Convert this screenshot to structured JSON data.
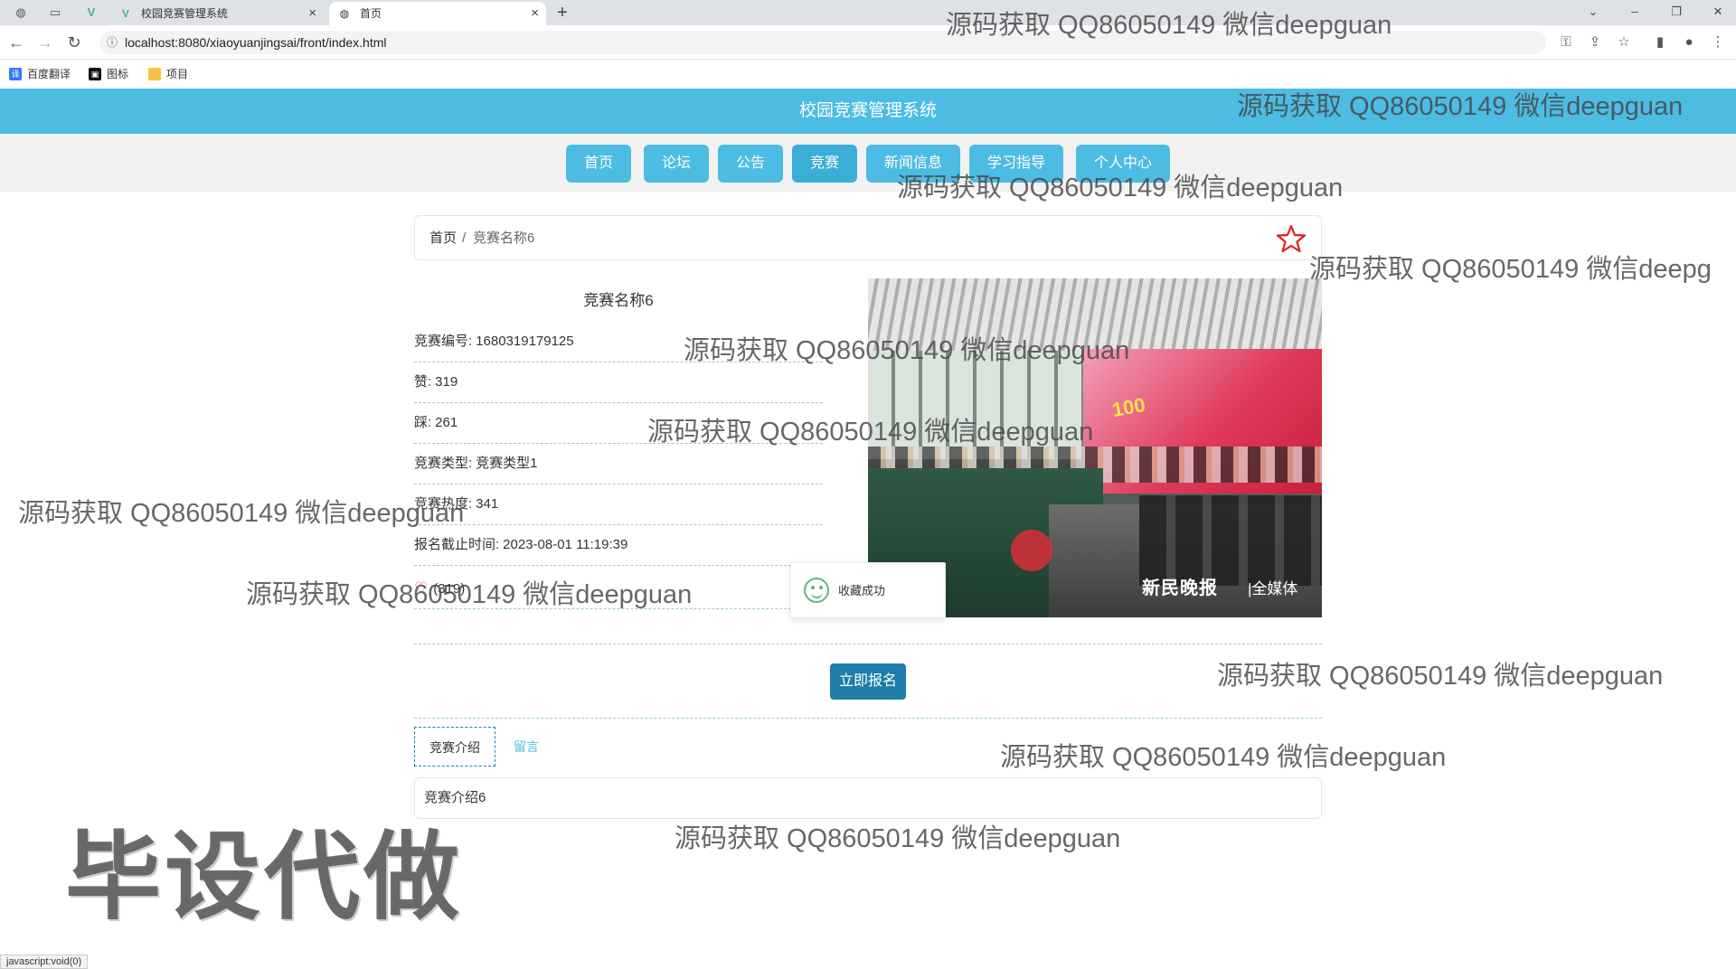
{
  "browser": {
    "tabs": [
      {
        "title": "校园竞赛管理系统",
        "favicon": "vue-logo-icon",
        "active": false
      },
      {
        "title": "首页",
        "favicon": "globe-icon",
        "active": true
      }
    ],
    "url": "localhost:8080/xiaoyuanjingsai/front/index.html",
    "bookmarks": [
      "百度翻译",
      "图标",
      "项目"
    ],
    "status_text": "javascript:void(0)"
  },
  "site": {
    "title": "校园竞赛管理系统",
    "nav": [
      "首页",
      "论坛",
      "公告",
      "竞赛",
      "新闻信息",
      "学习指导",
      "个人中心"
    ],
    "active_nav": "竞赛",
    "header_color": "#4cbce3"
  },
  "breadcrumb": {
    "home": "首页",
    "separator": "/",
    "current": "竞赛名称6"
  },
  "detail": {
    "title": "竞赛名称6",
    "fields": [
      {
        "label": "竞赛编号:",
        "value": "1680319179125"
      },
      {
        "label": "赞:",
        "value": "319"
      },
      {
        "label": "踩:",
        "value": "261"
      },
      {
        "label": "竞赛类型:",
        "value": "竞赛类型1"
      },
      {
        "label": "竞赛热度:",
        "value": "341"
      },
      {
        "label": "报名截止时间:",
        "value": "2023-08-01 11:19:39"
      }
    ],
    "like_count": "(319)",
    "photo_caption": "新民晚报",
    "photo_caption2": "|全媒体",
    "photo_stage_text": "100"
  },
  "toast": {
    "message": "收藏成功",
    "icon": "smile-icon"
  },
  "signup_button": "立即报名",
  "tabs": {
    "intro": "竞赛介绍",
    "message": "留言"
  },
  "intro_text": "竞赛介绍6",
  "watermark": {
    "text": "源码获取 QQ86050149 微信deepguan",
    "partial": "源码获取 QQ86050149 微信deepg",
    "big": "毕设代做"
  }
}
